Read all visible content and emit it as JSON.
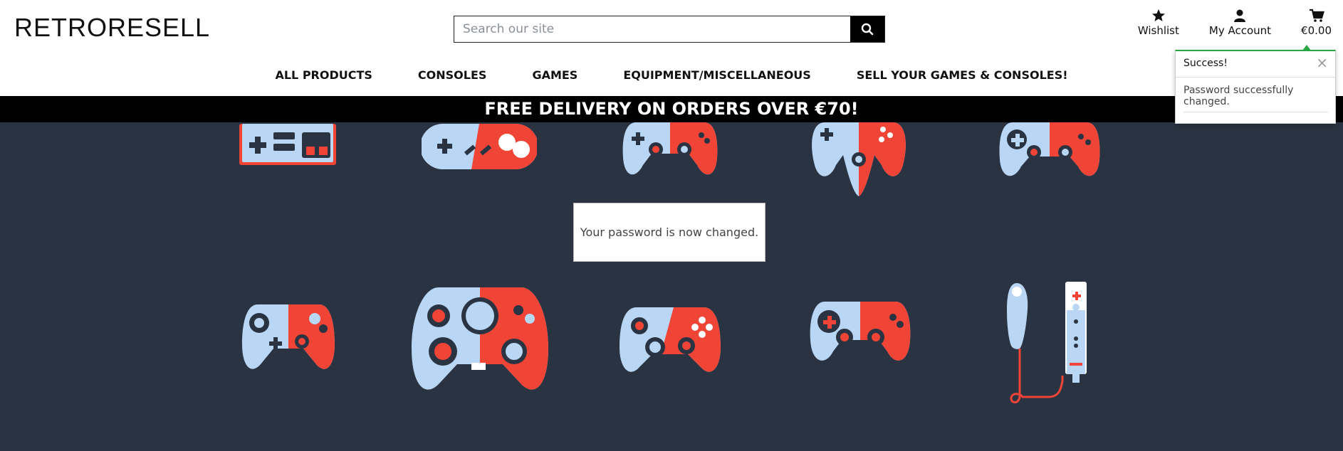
{
  "header": {
    "logo": "RETRORESELL",
    "search_placeholder": "Search our site",
    "wishlist_label": "Wishlist",
    "account_label": "My Account",
    "cart_total": "€0.00"
  },
  "nav": {
    "items": [
      "ALL PRODUCTS",
      "CONSOLES",
      "GAMES",
      "EQUIPMENT/MISCELLANEOUS",
      "SELL YOUR GAMES & CONSOLES!"
    ]
  },
  "banner": {
    "text": "FREE DELIVERY ON ORDERS OVER €70!"
  },
  "main": {
    "message": "Your password is now changed."
  },
  "toast": {
    "title": "Success!",
    "close": "×",
    "body": "Password successfully changed."
  },
  "colors": {
    "background": "#2a3342",
    "accent_red": "#f04437",
    "accent_blue": "#b9d6f5",
    "success": "#28a745"
  },
  "icons": [
    "search-icon",
    "star-icon",
    "user-icon",
    "cart-icon",
    "close-icon",
    "controller-icon"
  ]
}
